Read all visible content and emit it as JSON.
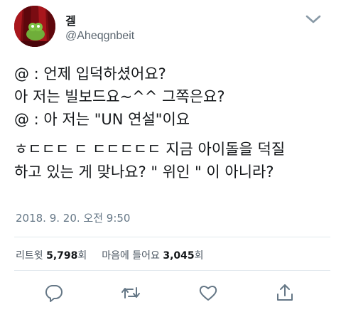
{
  "user": {
    "display_name": "겔",
    "handle": "@Aheqgnbeit"
  },
  "tweet": {
    "lines": [
      "@ : 언제 입덕하셨어요?",
      "아 저는 빌보드요~^^ 그쪽은요?",
      "@ : 아 저는 \"UN 연설\"이요"
    ],
    "lines2": [
      "ㅎㄷㄷㄷ ㄷ ㄷㄷㄷㄷㄷ 지금 아이돌을 덕질",
      "하고 있는 게 맞나요? \" 위인 \" 이 아니라?"
    ],
    "timestamp": "2018. 9. 20. 오전 9:50"
  },
  "stats": {
    "retweets_label": "리트윗",
    "retweets_count": "5,798",
    "retweets_unit": "회",
    "likes_label": "마음에 들어요",
    "likes_count": "3,045",
    "likes_unit": "회"
  },
  "actions": [
    "reply-icon",
    "retweet-icon",
    "like-icon",
    "share-icon"
  ],
  "colors": {
    "text": "#14171a",
    "secondary": "#657786",
    "divider": "#e1e8ed",
    "icon": "#657786"
  }
}
